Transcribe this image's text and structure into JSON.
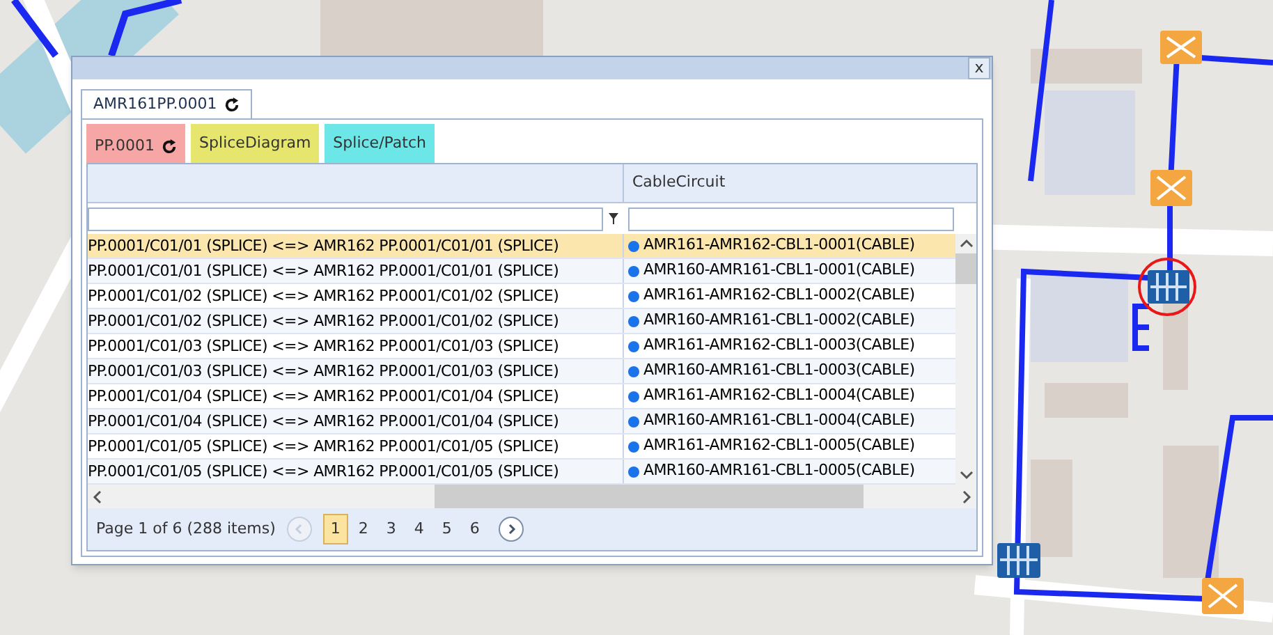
{
  "window": {
    "close_label": "x"
  },
  "outer_tab": {
    "label": "AMR161PP.0001",
    "selected": true
  },
  "tabs": [
    {
      "label": "PP.0001",
      "refresh": true,
      "selected": true,
      "color": "#f7a6a6"
    },
    {
      "label": "SpliceDiagram",
      "refresh": false,
      "selected": false,
      "color": "#e6e66e"
    },
    {
      "label": "Splice/Patch",
      "refresh": false,
      "selected": false,
      "color": "#6ce6e6"
    }
  ],
  "table": {
    "columns": [
      "",
      "CableCircuit"
    ],
    "rows": [
      {
        "cells": [
          "PP.0001/C01/01 (SPLICE) <=> AMR162 PP.0001/C01/01 (SPLICE)",
          "AMR161-AMR162-CBL1-0001(CABLE)"
        ],
        "selected": true
      },
      {
        "cells": [
          "PP.0001/C01/01 (SPLICE) <=> AMR162 PP.0001/C01/01 (SPLICE)",
          "AMR160-AMR161-CBL1-0001(CABLE)"
        ],
        "selected": false
      },
      {
        "cells": [
          "PP.0001/C01/02 (SPLICE) <=> AMR162 PP.0001/C01/02 (SPLICE)",
          "AMR161-AMR162-CBL1-0002(CABLE)"
        ],
        "selected": false
      },
      {
        "cells": [
          "PP.0001/C01/02 (SPLICE) <=> AMR162 PP.0001/C01/02 (SPLICE)",
          "AMR160-AMR161-CBL1-0002(CABLE)"
        ],
        "selected": false
      },
      {
        "cells": [
          "PP.0001/C01/03 (SPLICE) <=> AMR162 PP.0001/C01/03 (SPLICE)",
          "AMR161-AMR162-CBL1-0003(CABLE)"
        ],
        "selected": false
      },
      {
        "cells": [
          "PP.0001/C01/03 (SPLICE) <=> AMR162 PP.0001/C01/03 (SPLICE)",
          "AMR160-AMR161-CBL1-0003(CABLE)"
        ],
        "selected": false
      },
      {
        "cells": [
          "PP.0001/C01/04 (SPLICE) <=> AMR162 PP.0001/C01/04 (SPLICE)",
          "AMR161-AMR162-CBL1-0004(CABLE)"
        ],
        "selected": false
      },
      {
        "cells": [
          "PP.0001/C01/04 (SPLICE) <=> AMR162 PP.0001/C01/04 (SPLICE)",
          "AMR160-AMR161-CBL1-0004(CABLE)"
        ],
        "selected": false
      },
      {
        "cells": [
          "PP.0001/C01/05 (SPLICE) <=> AMR162 PP.0001/C01/05 (SPLICE)",
          "AMR161-AMR162-CBL1-0005(CABLE)"
        ],
        "selected": false
      },
      {
        "cells": [
          "PP.0001/C01/05 (SPLICE) <=> AMR162 PP.0001/C01/05 (SPLICE)",
          "AMR160-AMR161-CBL1-0005(CABLE)"
        ],
        "selected": false
      }
    ]
  },
  "pager": {
    "summary": "Page 1 of 6 (288 items)",
    "previous_disabled": true,
    "pages": [
      {
        "label": "1",
        "selected": true
      },
      {
        "label": "2",
        "selected": false
      },
      {
        "label": "3",
        "selected": false
      },
      {
        "label": "4",
        "selected": false
      },
      {
        "label": "5",
        "selected": false
      },
      {
        "label": "6",
        "selected": false
      }
    ]
  }
}
